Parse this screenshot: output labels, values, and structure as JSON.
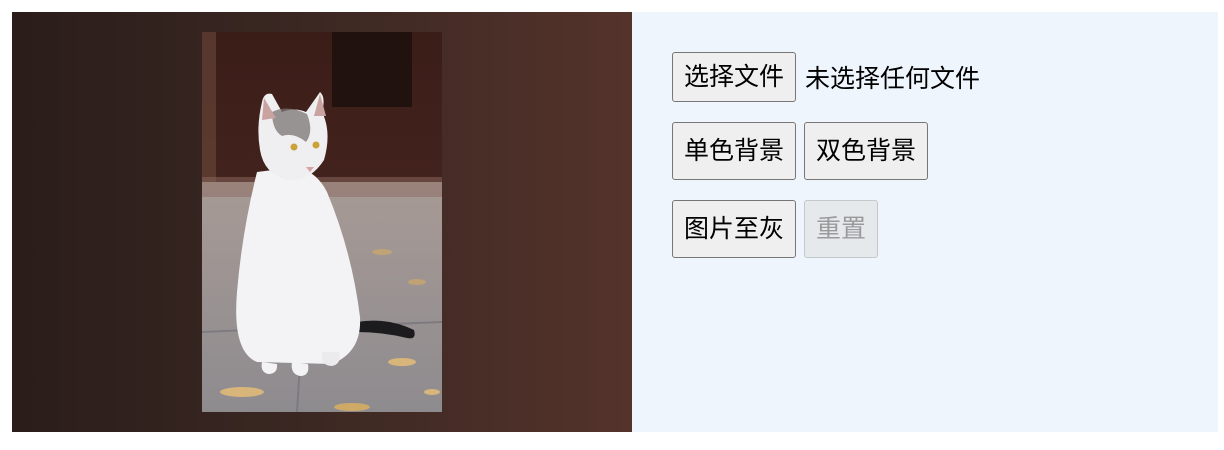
{
  "file_picker": {
    "choose_label": "选择文件",
    "status_text": "未选择任何文件"
  },
  "background_buttons": {
    "solid_label": "单色背景",
    "dual_label": "双色背景"
  },
  "image_buttons": {
    "grayscale_label": "图片至灰",
    "reset_label": "重置",
    "reset_disabled": true
  },
  "colors": {
    "preview_bg_start": "#2a1d1a",
    "preview_bg_end": "#54332b",
    "panel_bg": "#eef5fd"
  },
  "preview": {
    "subject": "white cat sitting on pavement with fallen leaves"
  }
}
